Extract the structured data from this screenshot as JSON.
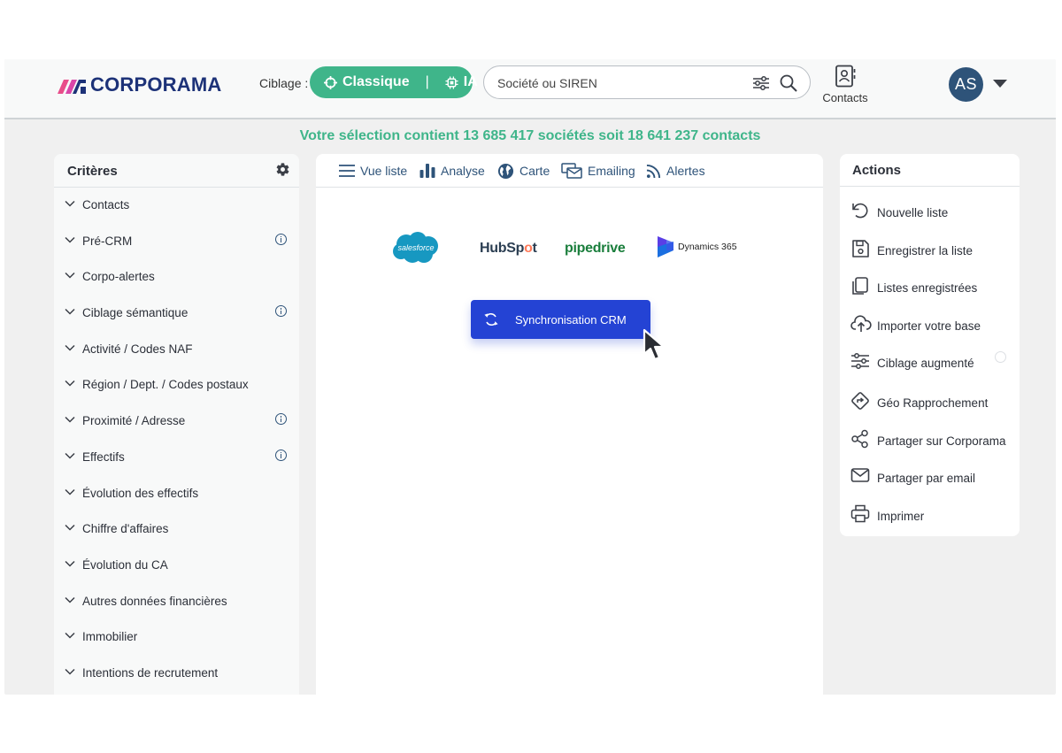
{
  "brand": {
    "name": "CORPORAMA"
  },
  "header": {
    "ciblage_label": "Ciblage :",
    "ciblage_options": [
      "Classique",
      "IA"
    ],
    "ciblage_selected": "Classique",
    "ciblage_separator": "|",
    "search_placeholder": "Société ou SIREN",
    "contacts_label": "Contacts",
    "avatar_initials": "AS"
  },
  "selection_summary": "Votre sélection contient 13 685 417 sociétés soit 18 641 237 contacts",
  "criteria": {
    "title": "Critères",
    "items": [
      {
        "label": "Contacts",
        "info": false
      },
      {
        "label": "Pré-CRM",
        "info": true
      },
      {
        "label": "Corpo-alertes",
        "info": false
      },
      {
        "label": "Ciblage sémantique",
        "info": true
      },
      {
        "label": "Activité / Codes NAF",
        "info": false
      },
      {
        "label": "Région / Dept. / Codes postaux",
        "info": false
      },
      {
        "label": "Proximité / Adresse",
        "info": true
      },
      {
        "label": "Effectifs",
        "info": true
      },
      {
        "label": "Évolution des effectifs",
        "info": false
      },
      {
        "label": "Chiffre d'affaires",
        "info": false
      },
      {
        "label": "Évolution du CA",
        "info": false
      },
      {
        "label": "Autres données financières",
        "info": false
      },
      {
        "label": "Immobilier",
        "info": false
      },
      {
        "label": "Intentions de recrutement",
        "info": false
      }
    ]
  },
  "tabs": [
    {
      "label": "Vue liste",
      "icon": "list-icon"
    },
    {
      "label": "Analyse",
      "icon": "bar-chart-icon"
    },
    {
      "label": "Carte",
      "icon": "globe-icon"
    },
    {
      "label": "Emailing",
      "icon": "emailing-icon"
    },
    {
      "label": "Alertes",
      "icon": "rss-icon"
    }
  ],
  "crm_logos": {
    "salesforce": "salesforce",
    "hubspot_pre": "HubSp",
    "hubspot_o": "o",
    "hubspot_post": "t",
    "pipedrive": "pipedrive",
    "dynamics": "Dynamics 365"
  },
  "sync_button_label": "Synchronisation CRM",
  "actions": {
    "title": "Actions",
    "items": [
      {
        "label": "Nouvelle liste",
        "icon": "undo-icon"
      },
      {
        "label": "Enregistrer la liste",
        "icon": "save-icon"
      },
      {
        "label": "Listes enregistrées",
        "icon": "copy-icon"
      },
      {
        "label": "Importer votre base",
        "icon": "cloud-upload-icon"
      },
      {
        "label": "Ciblage augmenté",
        "icon": "sliders-icon"
      },
      {
        "label": "Géo Rapprochement",
        "icon": "directions-icon"
      },
      {
        "label": "Partager sur Corporama",
        "icon": "share-icon"
      },
      {
        "label": "Partager par email",
        "icon": "mail-icon"
      },
      {
        "label": "Imprimer",
        "icon": "printer-icon"
      }
    ]
  },
  "colors": {
    "accent_green": "#3fb58a",
    "brand_navy": "#1d3278",
    "sync_blue": "#2443d4",
    "avatar": "#2e5379",
    "tab_text": "#2e5379"
  }
}
